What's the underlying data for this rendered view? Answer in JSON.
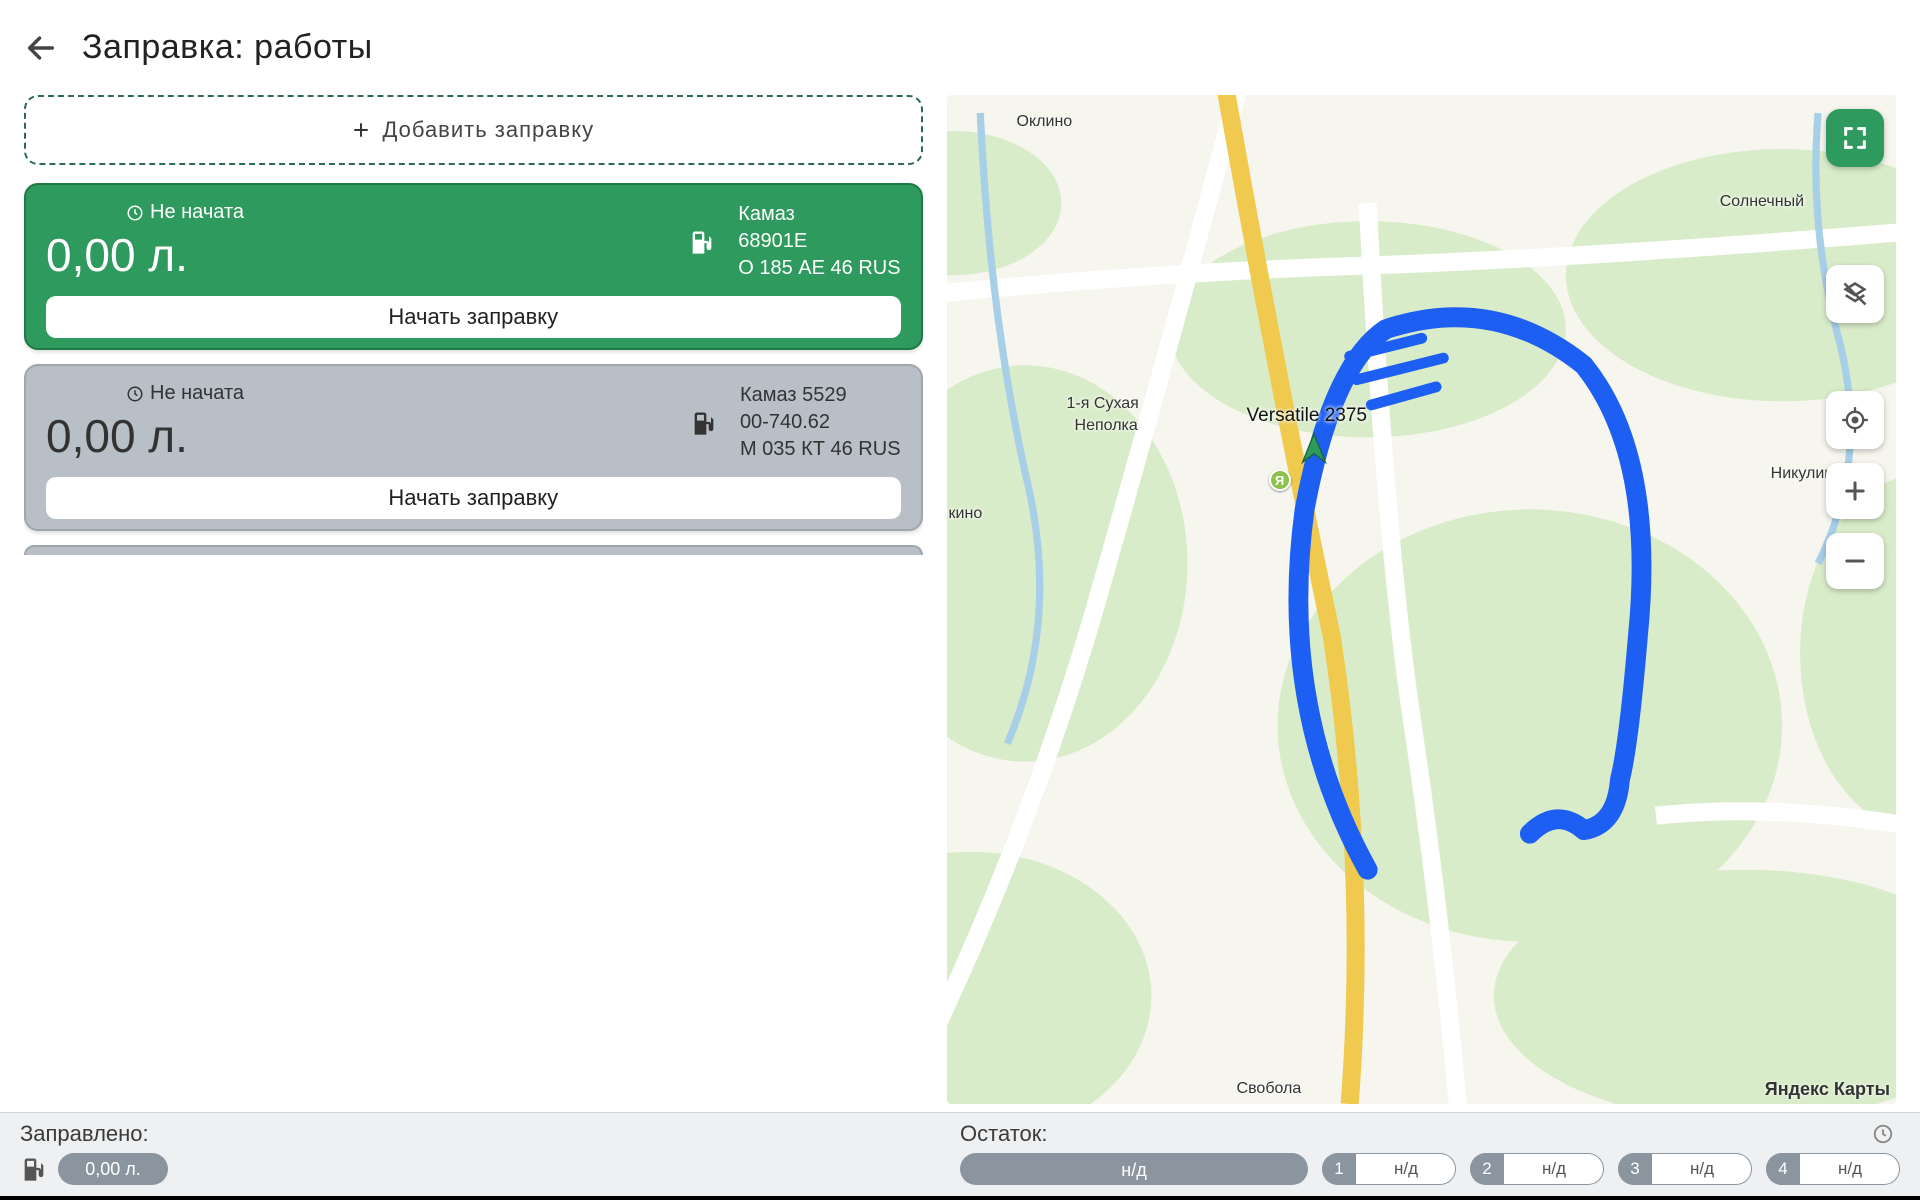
{
  "header": {
    "title": "Заправка: работы"
  },
  "add_button": {
    "label": "Добавить заправку"
  },
  "cards": [
    {
      "status": "Не начата",
      "volume": "0,00 л.",
      "vehicle_line1": "Камаз",
      "vehicle_line2": "68901E",
      "vehicle_line3": "О 185 АЕ 46 RUS",
      "action": "Начать заправку",
      "active": true
    },
    {
      "status": "Не начата",
      "volume": "0,00 л.",
      "vehicle_line1": "Камаз 5529",
      "vehicle_line2": "00-740.62",
      "vehicle_line3": "М 035 КТ 46 RUS",
      "action": "Начать заправку",
      "active": false
    }
  ],
  "map": {
    "labels": {
      "oklino": "Оклино",
      "solnechny": "Солнечный",
      "nepolka1": "1-я Сухая",
      "nepolka2": "Неполка",
      "nikulino": "Никулино",
      "svoboda": "Свобола",
      "kino_frag": "кино"
    },
    "vehicle_marker": "Versatile 2375",
    "attribution": "Яндекс Карты"
  },
  "footer": {
    "left_label": "Заправлено:",
    "right_label": "Остаток:",
    "fuel_pill": "0,00 л.",
    "remain_pill": "н/д",
    "chips": [
      {
        "num": "1",
        "val": "н/д"
      },
      {
        "num": "2",
        "val": "н/д"
      },
      {
        "num": "3",
        "val": "н/д"
      },
      {
        "num": "4",
        "val": "н/д"
      }
    ]
  }
}
